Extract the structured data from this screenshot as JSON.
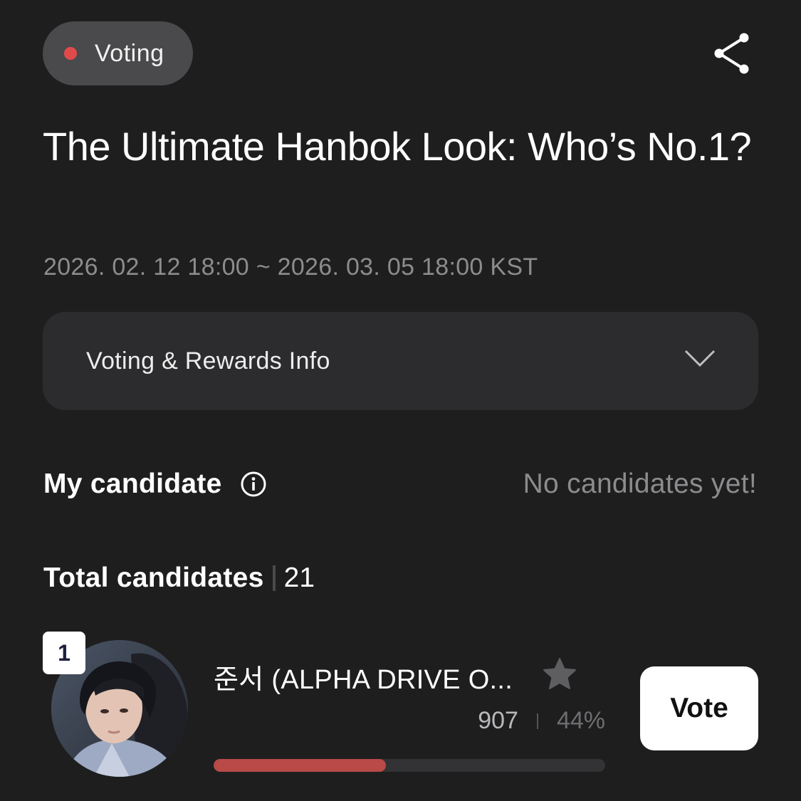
{
  "status": {
    "label": "Voting",
    "dot_color": "#e24a4a"
  },
  "header": {
    "share_icon": "share-icon"
  },
  "event": {
    "title": "The Ultimate Hanbok Look: Who’s No.1?",
    "period": "2026. 02. 12 18:00 ~ 2026. 03. 05 18:00 KST"
  },
  "info_accordion": {
    "label": "Voting & Rewards Info",
    "icon": "chevron-down-icon"
  },
  "my_candidate": {
    "heading": "My candidate",
    "info_icon": "info-icon",
    "empty_text": "No candidates yet!"
  },
  "total_candidates": {
    "heading": "Total candidates",
    "count": "21"
  },
  "candidates": [
    {
      "rank": "1",
      "name": "준서 (ALPHA DRIVE O...",
      "votes": "907",
      "percent": "44%",
      "percent_value": 0.44,
      "vote_label": "Vote",
      "bar_color": "#b94a47"
    }
  ]
}
